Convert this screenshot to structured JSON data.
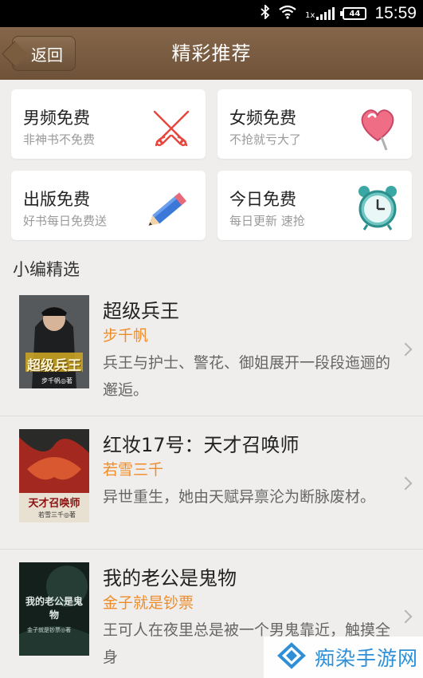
{
  "status_bar": {
    "time": "15:59",
    "battery": "44",
    "network_label": "1x"
  },
  "header": {
    "back_label": "返回",
    "title": "精彩推荐"
  },
  "categories": [
    {
      "title": "男频免费",
      "subtitle": "非神书不免费",
      "icon": "crossed-swords-icon"
    },
    {
      "title": "女频免费",
      "subtitle": "不抢就亏大了",
      "icon": "heart-lollipop-icon"
    },
    {
      "title": "出版免费",
      "subtitle": "好书每日免费送",
      "icon": "pencil-icon"
    },
    {
      "title": "今日免费",
      "subtitle": "每日更新 速抢",
      "icon": "alarm-clock-icon"
    }
  ],
  "section": {
    "title": "小编精选"
  },
  "books": [
    {
      "title": "超级兵王",
      "author": "步千帆",
      "desc": "兵王与护士、警花、御姐展开一段段迤逦的邂逅。",
      "cover_title": "超级兵王",
      "cover_author": "步千帆◎著"
    },
    {
      "title": "红妆17号：天才召唤师",
      "author": "若雪三千",
      "desc": "异世重生，她由天赋异禀沦为断脉废材。",
      "cover_title": "天才召唤师",
      "cover_author": "若雪三千◎著"
    },
    {
      "title": "我的老公是鬼物",
      "author": "金子就是钞票",
      "desc": "王可人在夜里总是被一个男鬼靠近，触摸全身",
      "cover_title": "我的老公是鬼物",
      "cover_author": "金子就是钞票◎著"
    }
  ],
  "watermark": {
    "text": "痴染手游网"
  },
  "colors": {
    "header": "#7a5c3e",
    "author": "#f08c28",
    "background": "#efeeec",
    "watermark": "#2f8fd6"
  }
}
